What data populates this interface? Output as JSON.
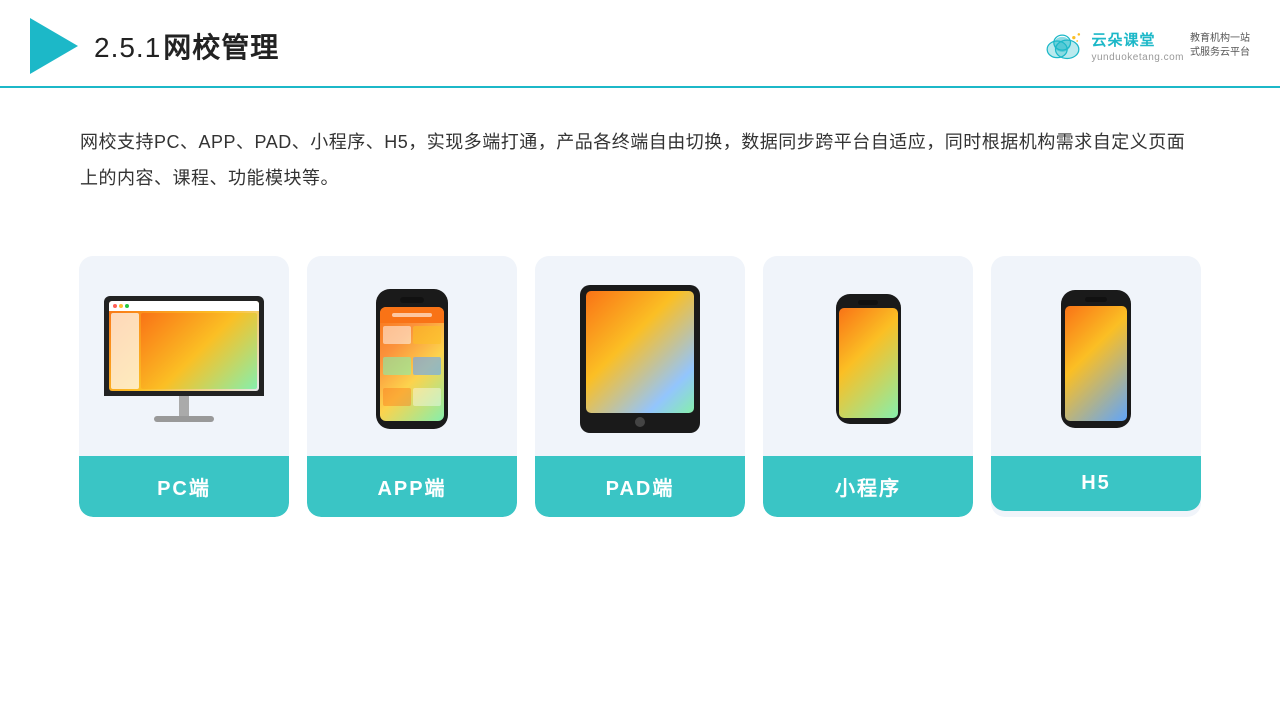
{
  "header": {
    "section_number": "2.5.1",
    "title": "网校管理",
    "brand": {
      "name": "云朵课堂",
      "url": "yunduoketang.com",
      "slogan": "教育机构一站\n式服务云平台"
    }
  },
  "description": {
    "text": "网校支持PC、APP、PAD、小程序、H5，实现多端打通，产品各终端自由切换，数据同步跨平台自适应，同时根据机构需求自定义页面上的内容、课程、功能模块等。"
  },
  "cards": [
    {
      "id": "pc",
      "label": "PC端"
    },
    {
      "id": "app",
      "label": "APP端"
    },
    {
      "id": "pad",
      "label": "PAD端"
    },
    {
      "id": "miniprogram",
      "label": "小程序"
    },
    {
      "id": "h5",
      "label": "H5"
    }
  ],
  "colors": {
    "accent": "#3ac5c5",
    "header_line": "#1cb8c8",
    "card_bg": "#f0f4fa",
    "text_dark": "#222222",
    "text_body": "#333333"
  }
}
